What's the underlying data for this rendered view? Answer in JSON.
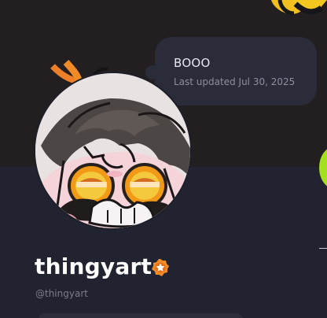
{
  "profile": {
    "username": "thingyart",
    "handle": "@thingyart",
    "verified_icon": "verified-badge-icon"
  },
  "status": {
    "text": "BOOO",
    "updated": "Last updated Jul 30, 2025"
  },
  "colors": {
    "banner": "#231f21",
    "panel": "#222330",
    "bubble": "#2b2c3a",
    "badge": "#f08b25",
    "accent": "#a4e01f"
  }
}
